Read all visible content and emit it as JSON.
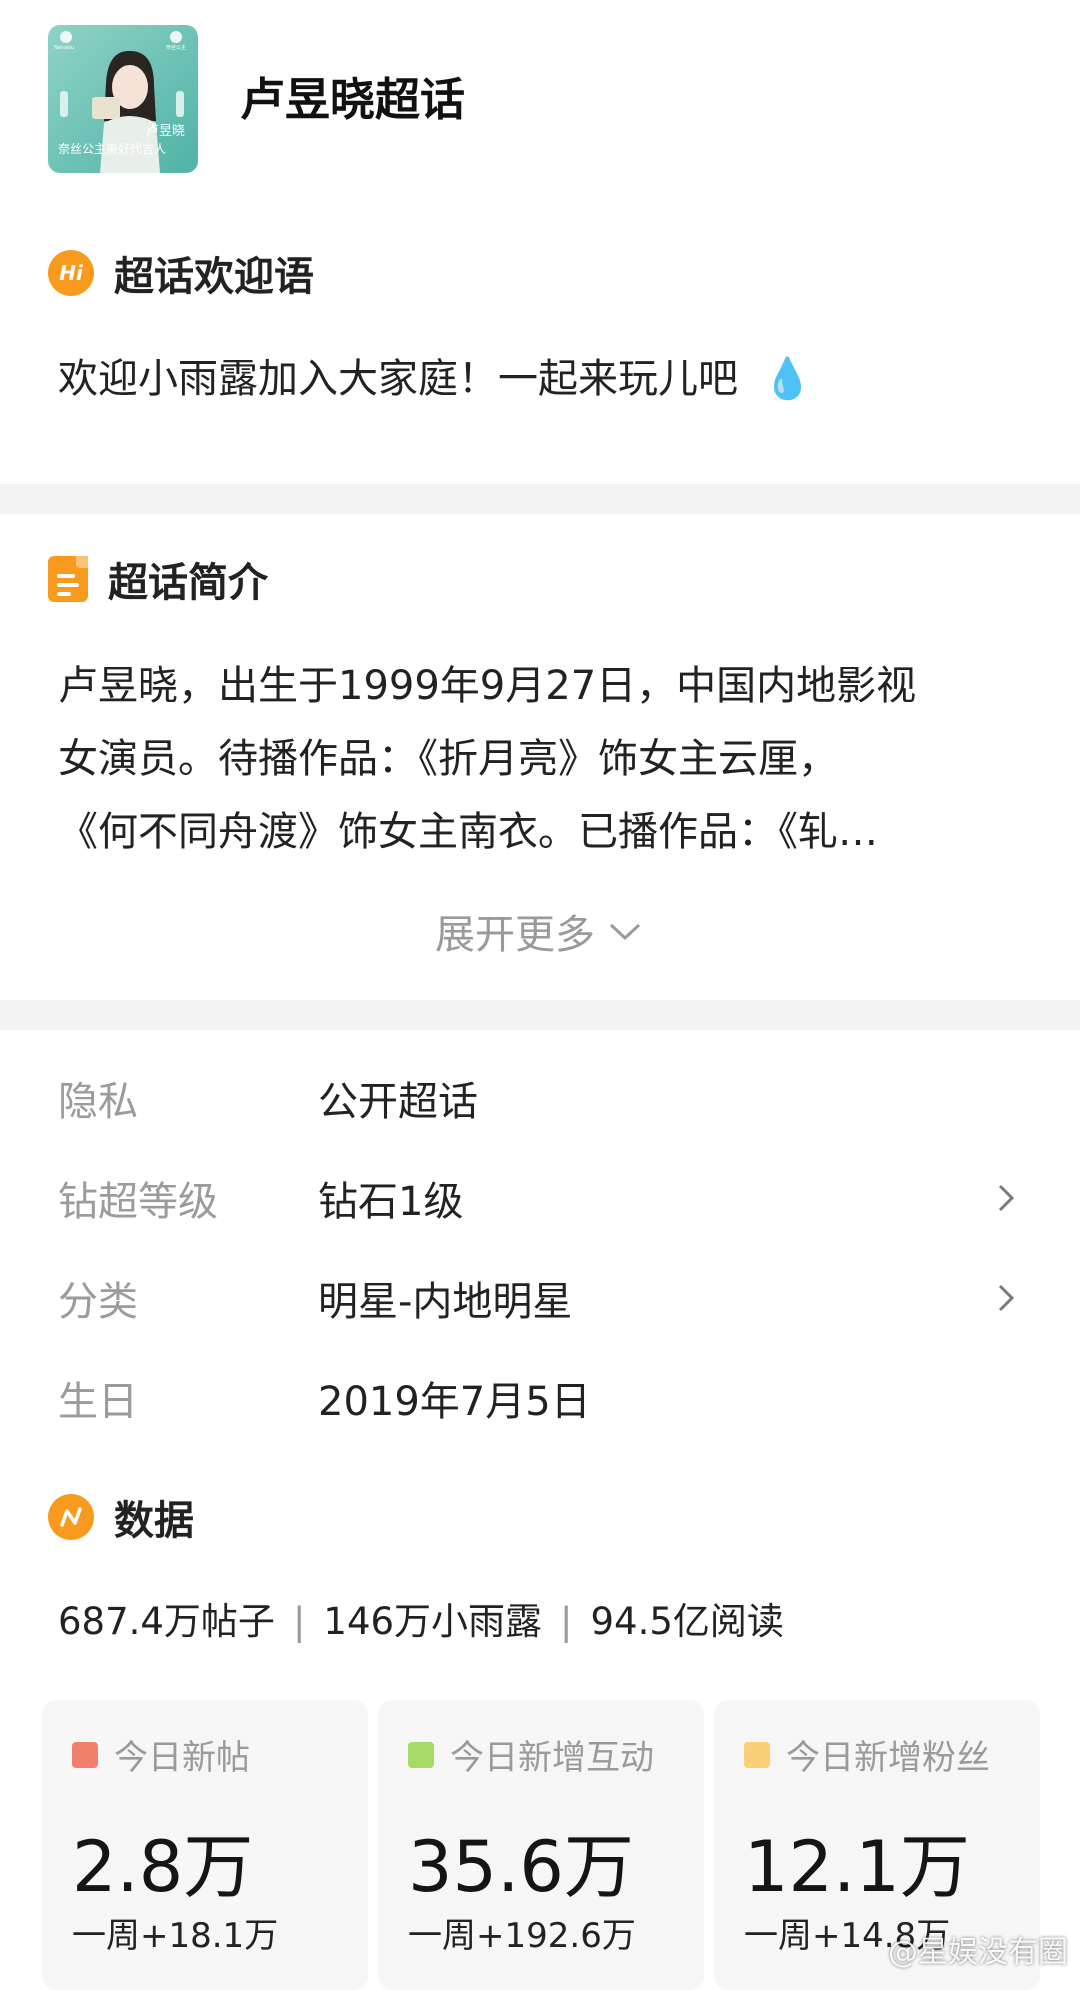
{
  "header": {
    "topic_title": "卢昱晓超话",
    "cover_name": "卢昱晓",
    "cover_caption": "奈丝公主美好代言人",
    "cover_brand_left": "Nanaisu",
    "cover_brand_right": "奈丝公主"
  },
  "welcome": {
    "icon_text": "Hi",
    "title": "超话欢迎语",
    "text": "欢迎小雨露加入大家庭！一起来玩儿吧",
    "emoji": "💧"
  },
  "intro": {
    "title": "超话简介",
    "line1": "卢昱晓，出生于1999年9月27日，中国内地影视",
    "line2": "女演员。待播作品：《折月亮》饰女主云厘，",
    "line3": "《何不同舟渡》饰女主南衣。已播作品：《轧…",
    "expand_label": "展开更多"
  },
  "info": {
    "rows": [
      {
        "key": "隐私",
        "value": "公开超话"
      },
      {
        "key": "钻超等级",
        "value": "钻石1级"
      },
      {
        "key": "分类",
        "value": "明星-内地明星"
      },
      {
        "key": "生日",
        "value": "2019年7月5日"
      }
    ]
  },
  "data_section": {
    "title": "数据",
    "posts": "687.4万帖子",
    "fans": "146万小雨露",
    "reads": "94.5亿阅读",
    "separator": "|",
    "cards": [
      {
        "label": "今日新帖",
        "value": "2.8万",
        "week": "一周+18.1万",
        "color": "#f0806b"
      },
      {
        "label": "今日新增互动",
        "value": "35.6万",
        "week": "一周+192.6万",
        "color": "#a4da66"
      },
      {
        "label": "今日新增粉丝",
        "value": "12.1万",
        "week": "一周+14.8万",
        "color": "#f9cf78"
      }
    ]
  },
  "watermark": "@星娱没有圈",
  "colors": {
    "accent_orange": "#f79a1e",
    "divider_gray": "#f3f3f3"
  }
}
